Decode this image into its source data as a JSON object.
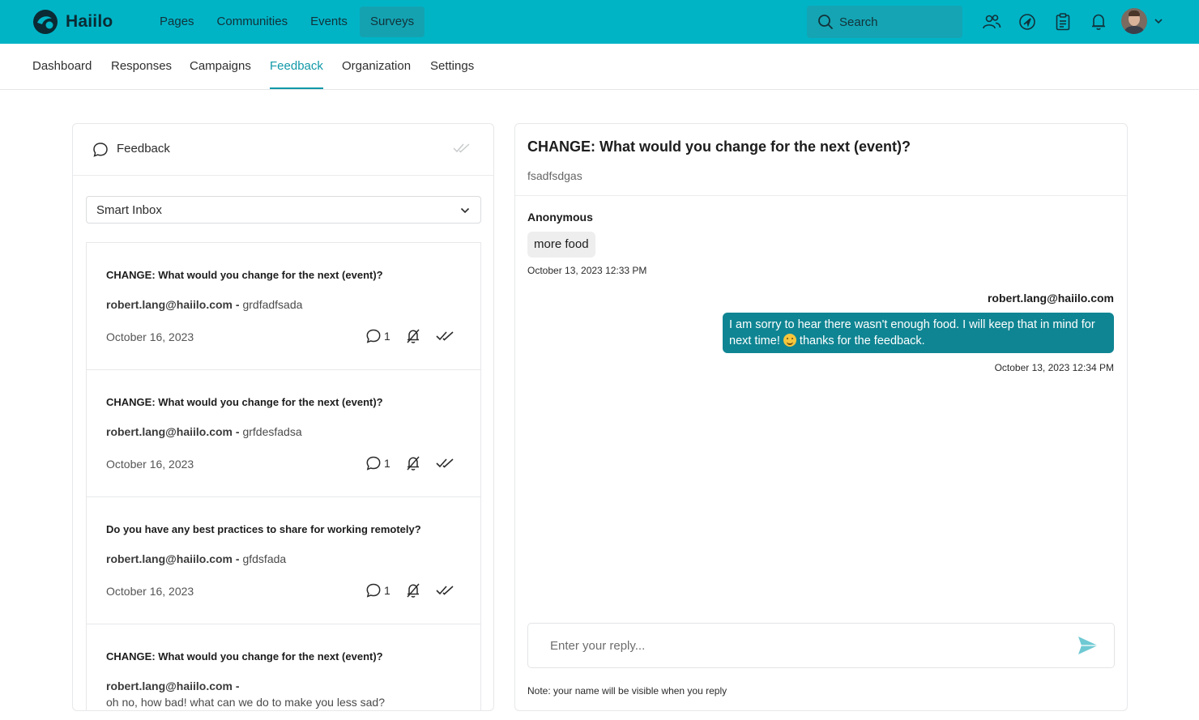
{
  "brand": {
    "name": "Haiilo",
    "accent": "#00b4c6",
    "teal_dark": "#0f8593"
  },
  "top_nav": [
    {
      "label": "Pages",
      "active": false
    },
    {
      "label": "Communities",
      "active": false
    },
    {
      "label": "Events",
      "active": false
    },
    {
      "label": "Surveys",
      "active": true
    }
  ],
  "search": {
    "placeholder": "Search",
    "icon": "search-icon"
  },
  "top_icons": [
    "colleagues-icon",
    "launchpad-icon",
    "clipboard-icon",
    "bell-icon"
  ],
  "sub_nav": [
    {
      "label": "Dashboard",
      "active": false
    },
    {
      "label": "Responses",
      "active": false
    },
    {
      "label": "Campaigns",
      "active": false
    },
    {
      "label": "Feedback",
      "active": true
    },
    {
      "label": "Organization",
      "active": false
    },
    {
      "label": "Settings",
      "active": false
    }
  ],
  "feedback_panel": {
    "title": "Feedback",
    "filter": {
      "selected": "Smart Inbox"
    },
    "items": [
      {
        "question": "CHANGE: What would you change for the next (event)?",
        "author": "robert.lang@haiilo.com",
        "separator": " - ",
        "excerpt": "grdfadfsada",
        "date": "October 16, 2023",
        "comments": "1"
      },
      {
        "question": "CHANGE: What would you change for the next (event)?",
        "author": "robert.lang@haiilo.com",
        "separator": " - ",
        "excerpt": "grfdesfadsa",
        "date": "October 16, 2023",
        "comments": "1"
      },
      {
        "question": "Do you have any best practices to share for working remotely?",
        "author": "robert.lang@haiilo.com",
        "separator": " - ",
        "excerpt": "gfdsfada",
        "date": "October 16, 2023",
        "comments": "1"
      },
      {
        "question": "CHANGE: What would you change for the next (event)?",
        "author": "robert.lang@haiilo.com",
        "separator": " - ",
        "excerpt": "oh no, how bad! what can we do to make you less sad?",
        "date": "",
        "comments": ""
      }
    ]
  },
  "detail": {
    "question": "CHANGE: What would you change for the next (event)?",
    "answer_label": "fsadfsdgas",
    "incoming": {
      "author": "Anonymous",
      "message": "more food",
      "timestamp": "October 13, 2023 12:33 PM"
    },
    "outgoing": {
      "author": "robert.lang@haiilo.com",
      "message_part1": "I am sorry to hear there wasn't enough food. I will keep that in mind for next time! ",
      "message_part2": " thanks for the feedback.",
      "timestamp": "October 13, 2023 12:34 PM"
    },
    "reply": {
      "placeholder": "Enter your reply...",
      "note": "Note: your name will be visible when you reply"
    }
  }
}
